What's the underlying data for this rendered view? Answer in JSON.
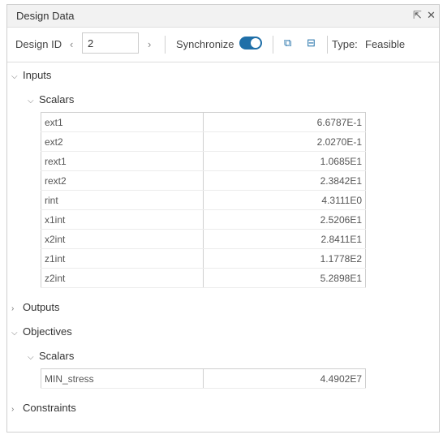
{
  "window": {
    "title": "Design Data",
    "popout_icon": "popout-icon",
    "close_icon": "close-icon"
  },
  "toolbar": {
    "design_id_label": "Design ID",
    "design_id_value": "2",
    "prev": "‹",
    "next": "›",
    "synchronize_label": "Synchronize",
    "synchronize_on": true,
    "expand_icon": "expand-all-icon",
    "collapse_icon": "collapse-all-icon",
    "type_label": "Type:",
    "type_value": "Feasible",
    "accent": "#1f6fa8"
  },
  "tree": {
    "inputs": {
      "label": "Inputs",
      "expanded": true,
      "scalars_label": "Scalars",
      "rows": [
        {
          "name": "ext1",
          "value": "6.6787E-1"
        },
        {
          "name": "ext2",
          "value": "2.0270E-1"
        },
        {
          "name": "rext1",
          "value": "1.0685E1"
        },
        {
          "name": "rext2",
          "value": "2.3842E1"
        },
        {
          "name": "rint",
          "value": "4.3111E0"
        },
        {
          "name": "x1int",
          "value": "2.5206E1"
        },
        {
          "name": "x2int",
          "value": "2.8411E1"
        },
        {
          "name": "z1int",
          "value": "1.1778E2"
        },
        {
          "name": "z2int",
          "value": "5.2898E1"
        }
      ]
    },
    "outputs": {
      "label": "Outputs",
      "expanded": false
    },
    "objectives": {
      "label": "Objectives",
      "expanded": true,
      "scalars_label": "Scalars",
      "rows": [
        {
          "name": "MIN_stress",
          "value": "4.4902E7"
        }
      ]
    },
    "constraints": {
      "label": "Constraints",
      "expanded": false
    }
  }
}
